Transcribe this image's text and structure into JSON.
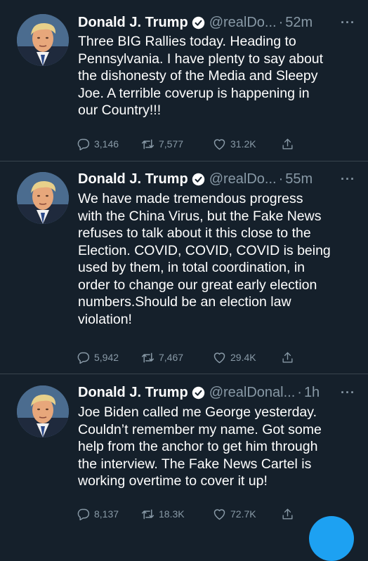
{
  "tweets": [
    {
      "name": "Donald J. Trump",
      "handle": "@realDo...",
      "separator": "·",
      "time": "52m",
      "more": "···",
      "text": "Three BIG Rallies today. Heading to\nPennsylvania. I have plenty to say about\nthe dishonesty of the Media and Sleepy\nJoe. A terrible coverup is happening in\nour Country!!!",
      "replies": "3,146",
      "retweets": "7,577",
      "likes": "31.2K"
    },
    {
      "name": "Donald J. Trump",
      "handle": "@realDo...",
      "separator": "·",
      "time": "55m",
      "more": "···",
      "text": "We have made tremendous progress\nwith the China Virus, but the Fake News\nrefuses to talk about it this close to the\nElection. COVID, COVID, COVID is being\nused by them, in total coordination, in\norder to change our great early election\nnumbers.Should be an election law\nviolation!",
      "replies": "5,942",
      "retweets": "7,467",
      "likes": "29.4K"
    },
    {
      "name": "Donald J. Trump",
      "handle": "@realDonal...",
      "separator": "·",
      "time": "1h",
      "more": "···",
      "text": "Joe Biden called me George yesterday.\nCouldn’t remember my name. Got some\nhelp from the anchor to get him through\nthe interview. The Fake News Cartel is\nworking overtime to cover it up!",
      "replies": "8,137",
      "retweets": "18.3K",
      "likes": "72.7K"
    }
  ],
  "icons": {
    "avatar": "profile-photo",
    "verified": "verified-badge-icon",
    "reply": "reply-icon",
    "retweet": "retweet-icon",
    "like": "heart-icon",
    "share": "share-icon"
  },
  "colors": {
    "background": "#15202b",
    "divider": "#38444d",
    "secondary_text": "#8899a6",
    "accent": "#1da1f2"
  }
}
